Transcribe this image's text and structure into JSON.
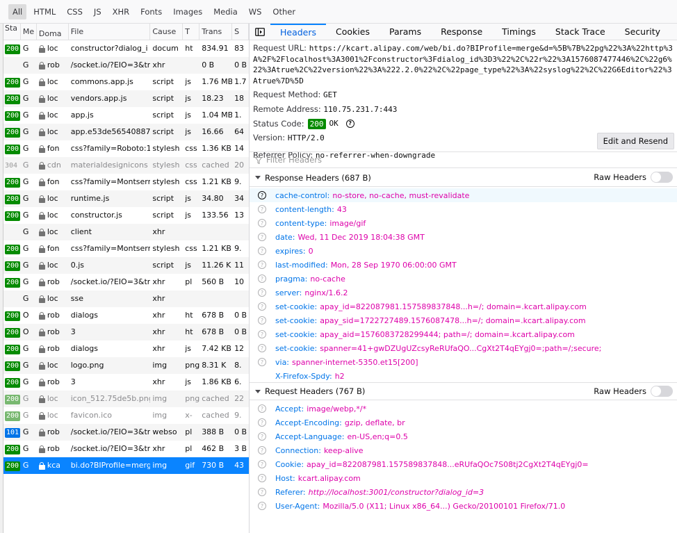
{
  "filter_tabs": [
    "All",
    "HTML",
    "CSS",
    "JS",
    "XHR",
    "Fonts",
    "Images",
    "Media",
    "WS",
    "Other"
  ],
  "columns": [
    "Sta",
    "Me",
    "Doma",
    "File",
    "Cause",
    "T",
    "Trans",
    "S"
  ],
  "requests": [
    {
      "status": "200",
      "method": "G",
      "domain": "loc",
      "file": "constructor?dialog_i",
      "cause": "docum",
      "type": "ht",
      "transferred": "834.91",
      "size": "83",
      "lock": true
    },
    {
      "status": "",
      "method": "G",
      "domain": "rob",
      "file": "/socket.io/?EIO=3&tr",
      "cause": "xhr",
      "type": "",
      "transferred": "0 B",
      "size": "0 B",
      "lock": true
    },
    {
      "status": "200",
      "method": "G",
      "domain": "loc",
      "file": "commons.app.js",
      "cause": "script",
      "type": "js",
      "transferred": "1.76 MB",
      "size": "1.7",
      "lock": true
    },
    {
      "status": "200",
      "method": "G",
      "domain": "loc",
      "file": "vendors.app.js",
      "cause": "script",
      "type": "js",
      "transferred": "18.23",
      "size": "18",
      "lock": true
    },
    {
      "status": "200",
      "method": "G",
      "domain": "loc",
      "file": "app.js",
      "cause": "script",
      "type": "js",
      "transferred": "1.04 MB",
      "size": "1.",
      "lock": true
    },
    {
      "status": "200",
      "method": "G",
      "domain": "loc",
      "file": "app.e53de56540887",
      "cause": "script",
      "type": "js",
      "transferred": "16.66",
      "size": "64",
      "lock": true
    },
    {
      "status": "200",
      "method": "G",
      "domain": "fon",
      "file": "css?family=Roboto:1",
      "cause": "stylesh",
      "type": "css",
      "transferred": "1.36 KB",
      "size": "14",
      "lock": true
    },
    {
      "status": "304",
      "method": "G",
      "domain": "cdn",
      "file": "materialdesignicons",
      "cause": "stylesh",
      "type": "css",
      "transferred": "cached",
      "size": "20",
      "lock": true,
      "muted": true
    },
    {
      "status": "200",
      "method": "G",
      "domain": "fon",
      "file": "css?family=Montserr",
      "cause": "stylesh",
      "type": "css",
      "transferred": "1.21 KB",
      "size": "9.",
      "lock": true
    },
    {
      "status": "200",
      "method": "G",
      "domain": "loc",
      "file": "runtime.js",
      "cause": "script",
      "type": "js",
      "transferred": "34.80",
      "size": "34",
      "lock": true
    },
    {
      "status": "200",
      "method": "G",
      "domain": "loc",
      "file": "constructor.js",
      "cause": "script",
      "type": "js",
      "transferred": "133.56",
      "size": "13",
      "lock": true
    },
    {
      "status": "",
      "method": "G",
      "domain": "loc",
      "file": "client",
      "cause": "xhr",
      "type": "",
      "transferred": "",
      "size": "",
      "lock": true
    },
    {
      "status": "200",
      "method": "G",
      "domain": "fon",
      "file": "css?family=Montserr",
      "cause": "stylesh",
      "type": "css",
      "transferred": "1.21 KB",
      "size": "9.",
      "lock": true
    },
    {
      "status": "200",
      "method": "G",
      "domain": "loc",
      "file": "0.js",
      "cause": "script",
      "type": "js",
      "transferred": "11.26 K",
      "size": "11",
      "lock": true
    },
    {
      "status": "200",
      "method": "G",
      "domain": "rob",
      "file": "/socket.io/?EIO=3&tr",
      "cause": "xhr",
      "type": "pl",
      "transferred": "560 B",
      "size": "10",
      "lock": true
    },
    {
      "status": "",
      "method": "G",
      "domain": "loc",
      "file": "sse",
      "cause": "xhr",
      "type": "",
      "transferred": "",
      "size": "",
      "lock": true
    },
    {
      "status": "200",
      "method": "O",
      "domain": "rob",
      "file": "dialogs",
      "cause": "xhr",
      "type": "ht",
      "transferred": "678 B",
      "size": "0 B",
      "lock": true
    },
    {
      "status": "200",
      "method": "O",
      "domain": "rob",
      "file": "3",
      "cause": "xhr",
      "type": "ht",
      "transferred": "678 B",
      "size": "0 B",
      "lock": true
    },
    {
      "status": "200",
      "method": "G",
      "domain": "rob",
      "file": "dialogs",
      "cause": "xhr",
      "type": "js",
      "transferred": "7.42 KB",
      "size": "12",
      "lock": true
    },
    {
      "status": "200",
      "method": "G",
      "domain": "loc",
      "file": "logo.png",
      "cause": "img",
      "type": "png",
      "transferred": "8.31 K",
      "size": "8.",
      "lock": true
    },
    {
      "status": "200",
      "method": "G",
      "domain": "rob",
      "file": "3",
      "cause": "xhr",
      "type": "js",
      "transferred": "1.86 KB",
      "size": "6.",
      "lock": true
    },
    {
      "status": "200",
      "method": "G",
      "domain": "loc",
      "file": "icon_512.75de5b.png",
      "cause": "img",
      "type": "png",
      "transferred": "cached",
      "size": "22",
      "lock": true,
      "muted": true,
      "cached": true
    },
    {
      "status": "200",
      "method": "G",
      "domain": "loc",
      "file": "favicon.ico",
      "cause": "img",
      "type": "x-",
      "transferred": "cached",
      "size": "9.",
      "lock": true,
      "muted": true,
      "cached": true
    },
    {
      "status": "101",
      "method": "G",
      "domain": "rob",
      "file": "/socket.io/?EIO=3&tr",
      "cause": "webso",
      "type": "pl",
      "transferred": "388 B",
      "size": "0 B",
      "lock": true
    },
    {
      "status": "200",
      "method": "G",
      "domain": "rob",
      "file": "/socket.io/?EIO=3&tr",
      "cause": "xhr",
      "type": "pl",
      "transferred": "462 B",
      "size": "3 B",
      "lock": true
    },
    {
      "status": "200",
      "method": "G",
      "domain": "kca",
      "file": "bi.do?BIProfile=merg",
      "cause": "img",
      "type": "gif",
      "transferred": "730 B",
      "size": "43",
      "lock": true,
      "selected": true
    }
  ],
  "detail_tabs": [
    "Headers",
    "Cookies",
    "Params",
    "Response",
    "Timings",
    "Stack Trace",
    "Security"
  ],
  "summary": {
    "url_label": "Request URL:",
    "url_value": "https://kcart.alipay.com/web/bi.do?BIProfile=merge&d=%5B%7B%22pg%22%3A%22http%3A%2F%2Flocalhost%3A3001%2Fconstructor%3Fdialog_id%3D3%22%2C%22r%22%3A1576087477446%2C%22g6%22%3Atrue%2C%22version%22%3A%222.2.0%22%2C%22page_type%22%3A%22syslog%22%2C%22G6Editor%22%3Atrue%7D%5D",
    "method_label": "Request Method:",
    "method_value": "GET",
    "remote_label": "Remote Address:",
    "remote_value": "110.75.231.7:443",
    "status_label": "Status Code:",
    "status_code": "200",
    "status_text": "OK",
    "version_label": "Version:",
    "version_value": "HTTP/2.0",
    "referrer_label": "Referrer Policy:",
    "referrer_value": "no-referrer-when-downgrade",
    "resend_label": "Edit and Resend",
    "filter_placeholder": "Filter Headers"
  },
  "response_headers": {
    "title": "Response Headers (687 B)",
    "raw_label": "Raw Headers",
    "items": [
      {
        "name": "cache-control:",
        "value": "no-store, no-cache, must-revalidate"
      },
      {
        "name": "content-length:",
        "value": "43"
      },
      {
        "name": "content-type:",
        "value": "image/gif"
      },
      {
        "name": "date:",
        "value": "Wed, 11 Dec 2019 18:04:38 GMT"
      },
      {
        "name": "expires:",
        "value": "0"
      },
      {
        "name": "last-modified:",
        "value": "Mon, 28 Sep 1970 06:00:00 GMT"
      },
      {
        "name": "pragma:",
        "value": "no-cache"
      },
      {
        "name": "server:",
        "value": "nginx/1.6.2"
      },
      {
        "name": "set-cookie:",
        "value": "apay_id=822087981.157589837848...h=/; domain=.kcart.alipay.com"
      },
      {
        "name": "set-cookie:",
        "value": "apay_sid=1722727489.1576087478...h=/; domain=.kcart.alipay.com"
      },
      {
        "name": "set-cookie:",
        "value": "apay_aid=1576083728299444; path=/; domain=.kcart.alipay.com"
      },
      {
        "name": "set-cookie:",
        "value": "spanner=41+gwDZUgUZcsyReRUfaQO...CgXt2T4qEYgj0=;path=/;secure;"
      },
      {
        "name": "via:",
        "value": "spanner-internet-5350.et15[200]"
      },
      {
        "name": "X-Firefox-Spdy:",
        "value": "h2"
      }
    ]
  },
  "request_headers": {
    "title": "Request Headers (767 B)",
    "raw_label": "Raw Headers",
    "items": [
      {
        "name": "Accept:",
        "value": "image/webp,*/*"
      },
      {
        "name": "Accept-Encoding:",
        "value": "gzip, deflate, br"
      },
      {
        "name": "Accept-Language:",
        "value": "en-US,en;q=0.5"
      },
      {
        "name": "Connection:",
        "value": "keep-alive"
      },
      {
        "name": "Cookie:",
        "value": "apay_id=822087981.157589837848...eRUfaQOc7S08tj2CgXt2T4qEYgj0="
      },
      {
        "name": "Host:",
        "value": "kcart.alipay.com"
      },
      {
        "name": "Referer:",
        "value": "http://localhost:3001/constructor?dialog_id=3"
      },
      {
        "name": "User-Agent:",
        "value": "Mozilla/5.0 (X11; Linux x86_64...) Gecko/20100101 Firefox/71.0"
      }
    ]
  },
  "colors": {
    "accent": "#0a84ff",
    "status_ok": "#058b00",
    "header_name": "#0074e8",
    "header_value": "#dd00a9"
  }
}
